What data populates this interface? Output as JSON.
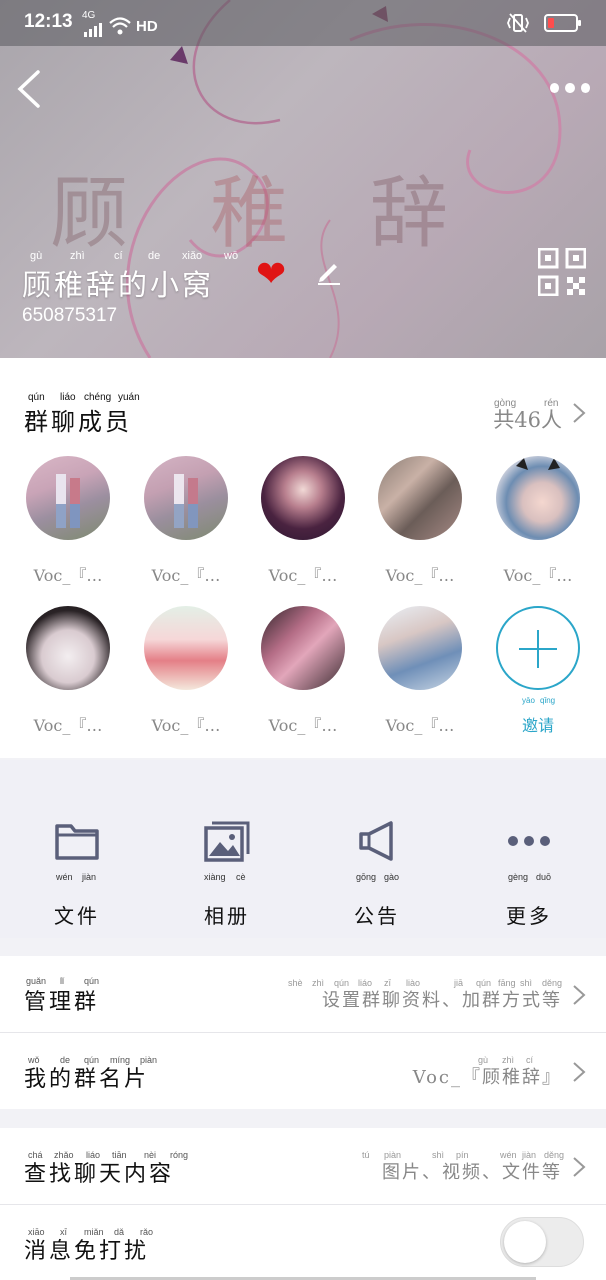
{
  "status_bar": {
    "time": "12:13",
    "signal": "4G",
    "hd": "HD"
  },
  "header": {
    "group_name": "顾稚辞的小窝",
    "group_name_pinyin": [
      "gù",
      "zhì",
      "cí",
      "de",
      "xiǎo",
      "wō"
    ],
    "group_id": "650875317"
  },
  "members_section": {
    "title": "群聊成员",
    "title_pinyin": [
      "qún",
      "liáo",
      "chéng",
      "yuán"
    ],
    "count_label": "共46人",
    "count_pinyin": [
      "gòng",
      "rén"
    ],
    "members": [
      {
        "name": "Voc_『…"
      },
      {
        "name": "Voc_『…"
      },
      {
        "name": "Voc_『…"
      },
      {
        "name": "Voc_『…"
      },
      {
        "name": "Voc_『…"
      },
      {
        "name": "Voc_『…"
      },
      {
        "name": "Voc_『…"
      },
      {
        "name": "Voc_『…"
      },
      {
        "name": "Voc_『…"
      }
    ],
    "invite_label": "邀请",
    "invite_pinyin": [
      "yāo",
      "qǐng"
    ]
  },
  "tools": [
    {
      "label": "文件",
      "pinyin": [
        "wén",
        "jiàn"
      ],
      "icon": "folder-icon"
    },
    {
      "label": "相册",
      "pinyin": [
        "xiàng",
        "cè"
      ],
      "icon": "album-icon"
    },
    {
      "label": "公告",
      "pinyin": [
        "gōng",
        "gào"
      ],
      "icon": "megaphone-icon"
    },
    {
      "label": "更多",
      "pinyin": [
        "gèng",
        "duō"
      ],
      "icon": "more-dots-icon"
    }
  ],
  "settings": {
    "manage_group": {
      "label": "管理群",
      "pinyin": [
        "guǎn",
        "lǐ",
        "qún"
      ],
      "value": "设置群聊资料、加群方式等",
      "value_pinyin": [
        "shè",
        "zhì",
        "qún",
        "liáo",
        "zī",
        "liào",
        "jiā",
        "qún",
        "fāng",
        "shì",
        "děng"
      ]
    },
    "my_card": {
      "label": "我的群名片",
      "pinyin": [
        "wǒ",
        "de",
        "qún",
        "míng",
        "piàn"
      ],
      "value": "Voc_『顾稚辞』",
      "value_pinyin": [
        "gù",
        "zhì",
        "cí"
      ]
    },
    "search_history": {
      "label": "查找聊天内容",
      "pinyin": [
        "chá",
        "zhǎo",
        "liáo",
        "tiān",
        "nèi",
        "róng"
      ],
      "value": "图片、视频、文件等",
      "value_pinyin": [
        "tú",
        "piàn",
        "shì",
        "pín",
        "wén",
        "jiàn",
        "děng"
      ]
    },
    "mute": {
      "label": "消息免打扰",
      "pinyin": [
        "xiāo",
        "xī",
        "miǎn",
        "dǎ",
        "rǎo"
      ],
      "enabled": false
    }
  },
  "colors": {
    "accent": "#2ba6c9",
    "heart": "#e01414",
    "icon": "#5a5f7a"
  }
}
